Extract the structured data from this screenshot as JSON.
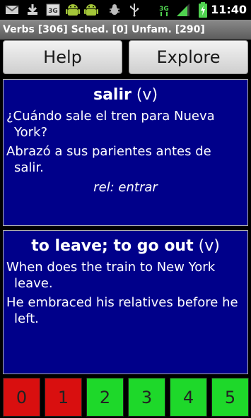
{
  "status_bar": {
    "time": "11:40",
    "icons": [
      "gmail-icon",
      "download-icon",
      "3g-icon",
      "android-icon",
      "android-icon",
      "bug-icon",
      "usb-icon",
      "3g-signal-icon",
      "signal-bars-icon",
      "battery-charging-icon"
    ]
  },
  "title_bar": {
    "text": "Verbs [306] Sched. [0] Unfam. [290]"
  },
  "buttons": {
    "help": "Help",
    "explore": "Explore"
  },
  "spanish_card": {
    "word": "salir",
    "pos": "(v)",
    "sentence1": "¿Cuándo sale el tren para Nueva York?",
    "sentence2": "Abrazó a sus parientes antes de salir.",
    "related": "rel: entrar"
  },
  "english_card": {
    "word": "to leave; to go out",
    "pos": "(v)",
    "sentence1": "When does the train to New York leave.",
    "sentence2": "He embraced his relatives before he left."
  },
  "ratings": [
    {
      "label": "0",
      "color": "#d90f0f"
    },
    {
      "label": "1",
      "color": "#d90f0f"
    },
    {
      "label": "2",
      "color": "#1ed82a"
    },
    {
      "label": "3",
      "color": "#1ed82a"
    },
    {
      "label": "4",
      "color": "#1ed82a"
    },
    {
      "label": "5",
      "color": "#1ed82a"
    }
  ],
  "colors": {
    "card_background": "#00008a",
    "title_bar": "#707070"
  }
}
